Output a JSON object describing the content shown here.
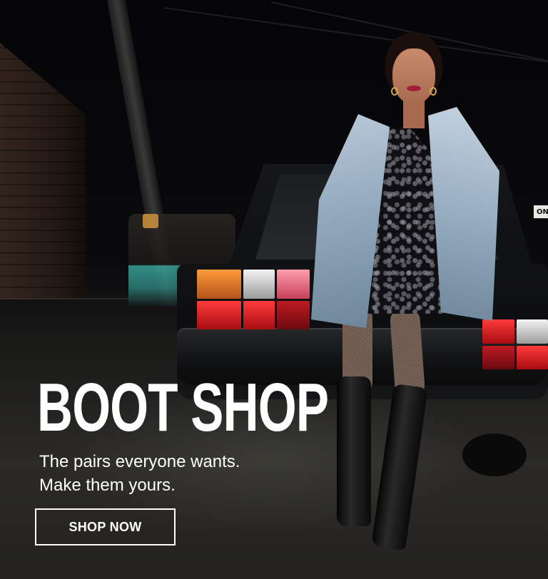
{
  "banner": {
    "title": "BOOT SHOP",
    "subtitle_lines": [
      "The pairs everyone wants.",
      "Make them yours."
    ],
    "cta_label": "SHOP NOW"
  },
  "scene": {
    "sign_text": "ON",
    "image_description_icon": "model-photo"
  },
  "colors": {
    "text": "#ffffff",
    "background": "#0b0b0c",
    "cta_border": "#ffffff"
  }
}
